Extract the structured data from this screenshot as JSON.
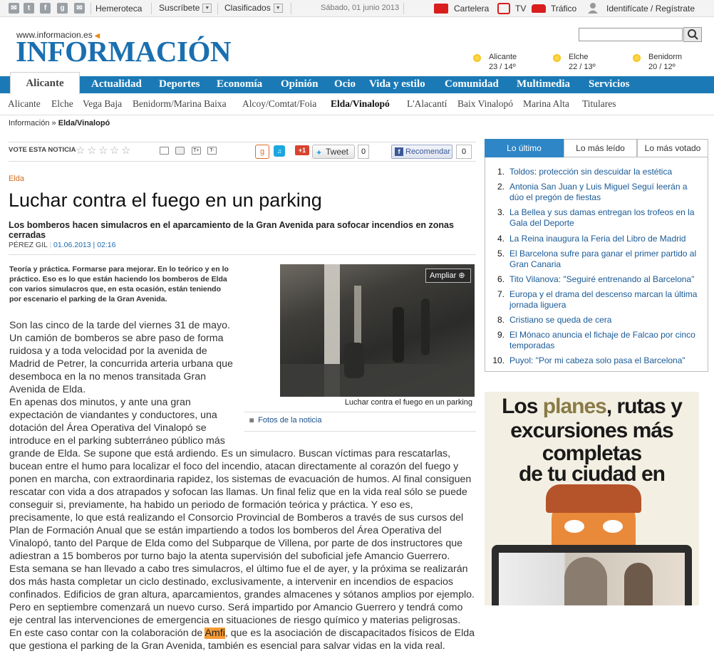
{
  "topbar": {
    "hemeroteca": "Hemeroteca",
    "suscribete": "Suscríbete",
    "clasificados": "Clasificados",
    "date": "Sábado, 01 junio 2013",
    "cartelera": "Cartelera",
    "tv": "TV",
    "trafico": "Tráfico",
    "login": "Identifícate / Regístrate"
  },
  "masthead": {
    "url": "www.informacion.es",
    "logo": "INFORMACIÓN"
  },
  "weather": [
    {
      "city": "Alicante",
      "temp": "23 / 14º"
    },
    {
      "city": "Elche",
      "temp": "22 / 13º"
    },
    {
      "city": "Benidorm",
      "temp": "20 / 12º"
    }
  ],
  "nav": {
    "active_tab": "Alicante",
    "items": [
      "Actualidad",
      "Deportes",
      "Economía",
      "Opinión",
      "Ocio",
      "Vida y estilo",
      "Comunidad",
      "Multimedia",
      "Servicios"
    ]
  },
  "subnav": [
    "Alicante",
    "Elche",
    "Vega Baja",
    "Benidorm/Marina Baixa",
    "Alcoy/Comtat/Foia",
    "Elda/Vinalopó",
    "L'Alacantí",
    "Baix Vinalopó",
    "Marina Alta",
    "Titulares"
  ],
  "breadcrumb": {
    "home": "Información",
    "sep": "»",
    "current": "Elda/Vinalopó"
  },
  "vote": {
    "label": "VOTE ESTA NOTICIA",
    "stars": 5
  },
  "social": {
    "gplus": "+1",
    "tweet": "Tweet",
    "tweet_count": "0",
    "recommend": "Recomendar",
    "recommend_count": "0"
  },
  "article": {
    "section": "Elda",
    "title": "Luchar contra el fuego en un parking",
    "subtitle": "Los bomberos hacen simulacros en el aparcamiento de la Gran Avenida para sofocar incendios en zonas cerradas",
    "author": "PÉREZ GIL",
    "date": "01.06.2013",
    "time": "02:16",
    "lead": "Teoría y práctica. Formarse para mejorar. En lo teórico y en lo práctico. Eso es lo que están haciendo los bomberos de Elda con varios simulacros que, en esta ocasión, están teniendo por escenario el parking de la Gran Avenida.",
    "photo_zoom": "Ampliar",
    "photo_caption": "Luchar contra el fuego en un parking",
    "photos_link": "Fotos de la noticia",
    "body_p1": "Son las cinco de la tarde del viernes 31 de mayo. Un camión de bomberos se abre paso de forma ruidosa y a toda velocidad por la avenida de Madrid de Petrer, la concurrida arteria urbana que desemboca en la no menos transitada Gran Avenida de Elda.",
    "body_p2a": "En apenas dos minutos, y ante una gran expectación de viandantes y conductores, una dotación del Área Operativa del Vinalopó se introduce en el parking subterráneo público más",
    "body_p2b": "grande de Elda. Se supone que está ardiendo. Es un simulacro. Buscan víctimas para rescatarlas, bucean entre el humo para localizar el foco del incendio, atacan directamente al corazón del fuego y ponen en marcha, con extraordinaria rapidez, los sistemas de evacuación de humos. Al final consiguen rescatar con vida a dos atrapados y sofocan las llamas. Un final feliz que en la vida real sólo se puede conseguir si, previamente, ha habido un periodo de formación teórica y práctica. Y eso es, precisamente, lo que está realizando el Consorcio Provincial de Bomberos a través de sus cursos del Plan de Formación Anual que se están impartiendo a todos los bomberos del Área Operativa del Vinalopó, tanto del Parque de Elda como del Subparque de Villena, por parte de dos instructores que adiestran a 15 bomberos por turno bajo la atenta supervisión del suboficial jefe Amancio Guerrero.",
    "body_p3": "Esta semana se han llevado a cabo tres simulacros, el último fue el de ayer, y la próxima se realizarán dos más hasta completar un ciclo destinado, exclusivamente, a intervenir en incendios de espacios confinados. Edificios de gran altura, aparcamientos, grandes almacenes y sótanos amplios por ejemplo. Pero en septiembre comenzará un nuevo curso. Será impartido por Amancio Guerrero y tendrá como eje central las intervenciones de emergencia en situaciones de riesgo químico y materias peligrosas.",
    "body_p4_pre": "En este caso contar con la colaboración de ",
    "body_p4_hl": "Amfi",
    "body_p4_post": ", que es la asociación de discapacitados físicos de Elda que gestiona el parking de la Gran Avenida, también es esencial para salvar vidas en la vida real."
  },
  "sidebar": {
    "tabs": [
      "Lo último",
      "Lo más leído",
      "Lo más votado"
    ],
    "items": [
      {
        "n": "1.",
        "t": "Toldos: protección sin descuidar la estética"
      },
      {
        "n": "2.",
        "t": "Antonia San Juan y Luis Miguel Seguí leerán a dúo el pregón de fiestas"
      },
      {
        "n": "3.",
        "t": "La Bellea y sus damas entregan los trofeos en la Gala del Deporte"
      },
      {
        "n": "4.",
        "t": "La Reina inaugura la Feria del Libro de Madrid"
      },
      {
        "n": "5.",
        "t": "El Barcelona sufre para ganar el primer partido al Gran Canaria"
      },
      {
        "n": "6.",
        "t": "Tito Vilanova: \"Seguiré entrenando al Barcelona\""
      },
      {
        "n": "7.",
        "t": "Europa y el drama del descenso marcan la última jornada liguera"
      },
      {
        "n": "8.",
        "t": "Cristiano se queda de cera"
      },
      {
        "n": "9.",
        "t": "El Mónaco anuncia el fichaje de Falcao por cinco temporadas"
      },
      {
        "n": "10.",
        "t": "Puyol: \"Por mi cabeza solo pasa el Barcelona\""
      }
    ]
  },
  "ad": {
    "line1a": "Los ",
    "line1b": "planes",
    "line1c": ", rutas y",
    "line2": "excursiones más",
    "line3": "completas",
    "line4": "de tu ciudad en"
  },
  "colors": {
    "brand": "#1b7ab6",
    "section": "#d46b1a",
    "highlight": "#f59b34"
  }
}
